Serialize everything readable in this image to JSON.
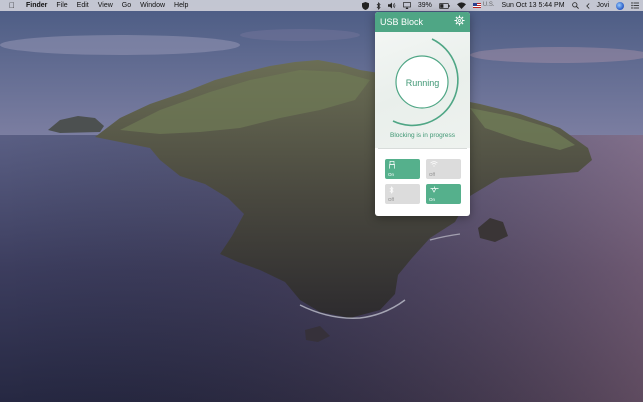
{
  "menubar": {
    "app_name": "Finder",
    "menus": [
      "File",
      "Edit",
      "View",
      "Go",
      "Window",
      "Help"
    ],
    "battery": "39%",
    "input_source": "U.S.",
    "datetime": "Sun Oct 13  5:44 PM",
    "user": "Jovi"
  },
  "usb_block": {
    "title": "USB Block",
    "status": "Running",
    "status_message": "Blocking is in progress",
    "accent_color": "#4fa685",
    "toggles": [
      {
        "icon": "usb-drive-icon",
        "state": "On"
      },
      {
        "icon": "wifi-icon",
        "state": "Off"
      },
      {
        "icon": "bluetooth-icon",
        "state": "Off"
      },
      {
        "icon": "network-icon",
        "state": "On"
      }
    ]
  }
}
